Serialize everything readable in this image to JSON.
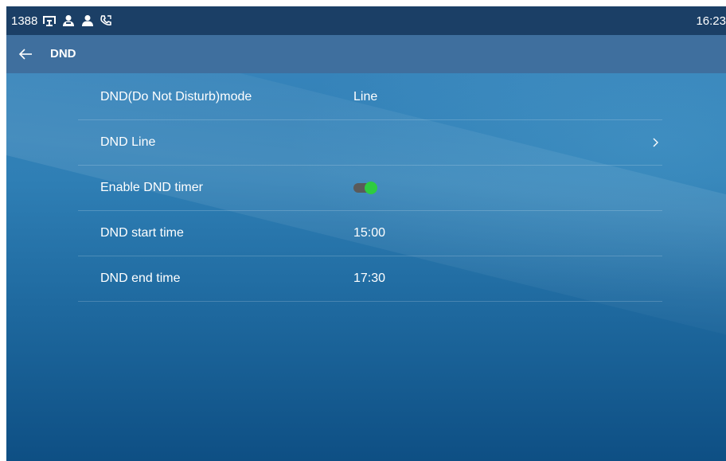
{
  "status_bar": {
    "extension": "1388",
    "time": "16:23",
    "icons": [
      "voicemail-icon",
      "contacts-icon",
      "user-icon",
      "call-forward-icon"
    ]
  },
  "header": {
    "title": "DND",
    "back_icon": "back-arrow-icon"
  },
  "settings": [
    {
      "label": "DND(Do Not Disturb)mode",
      "value": "Line"
    },
    {
      "label": "DND Line",
      "value": ""
    },
    {
      "label": "Enable DND timer",
      "toggle": "on"
    },
    {
      "label": "DND start time",
      "value": "15:00"
    },
    {
      "label": "DND end time",
      "value": "17:30"
    }
  ],
  "colors": {
    "status_bar": "#1b3f66",
    "title_bar": "#3f6f9e",
    "toggle_on": "#2ecc40"
  }
}
